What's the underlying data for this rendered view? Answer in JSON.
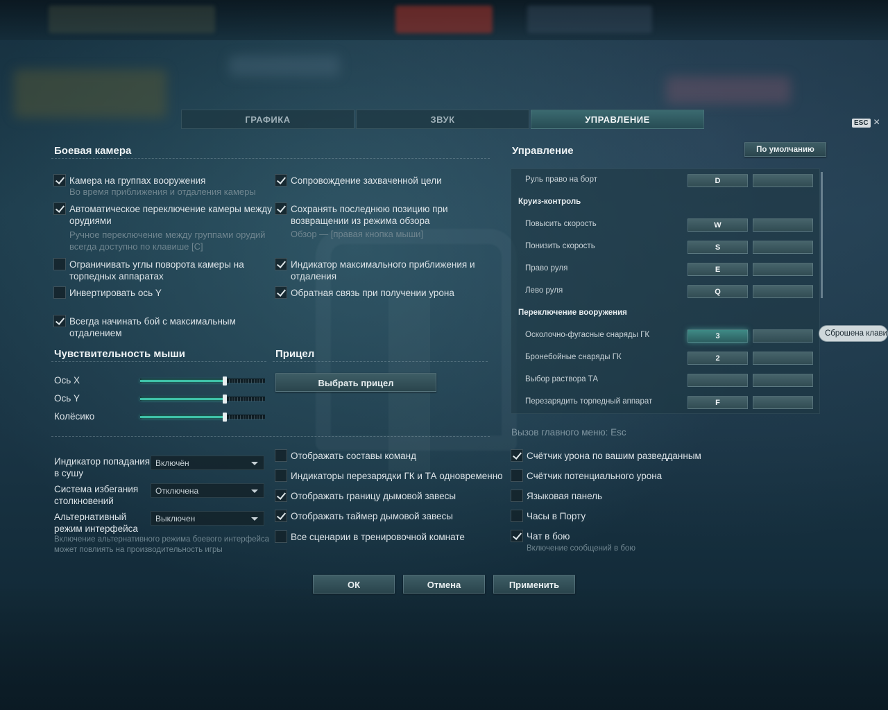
{
  "tabs": [
    {
      "label": "ГРАФИКА"
    },
    {
      "label": "ЗВУК"
    },
    {
      "label": "УПРАВЛЕНИЕ"
    }
  ],
  "esc_label": "ESC",
  "close_glyph": "×",
  "camera": {
    "title": "Боевая камера",
    "items": [
      {
        "label": "Камера на группах вооружения",
        "hint": "Во время приближения и отдаления камеры",
        "checked": true
      },
      {
        "label_line1": "Автоматическое переключение камеры между",
        "label_line2": "орудиями",
        "hint_line1": "Ручное переключение между группами орудий",
        "hint_line2": "всегда доступно по клавише [C]",
        "checked": true
      },
      {
        "label_line1": "Ограничивать углы поворота камеры на",
        "label_line2": "торпедных аппаратах",
        "checked": false
      },
      {
        "label": "Инвертировать ось Y",
        "checked": false
      },
      {
        "label_line1": "Всегда начинать бой с максимальным",
        "label_line2": "отдалением",
        "checked": true
      },
      {
        "label": "Сопровождение захваченной цели",
        "checked": true
      },
      {
        "label_line1": "Сохранять последнюю позицию при",
        "label_line2": "возвращении из режима обзора",
        "hint": "Обзор — [правая кнопка мыши]",
        "checked": true
      },
      {
        "label_line1": "Индикатор максимального приближения и",
        "label_line2": "отдаления",
        "checked": true
      },
      {
        "label": "Обратная связь при получении урона",
        "checked": true
      }
    ]
  },
  "mouse": {
    "title": "Чувствительность мыши",
    "sliders": [
      {
        "label": "Ось X",
        "value": 0.68
      },
      {
        "label": "Ось Y",
        "value": 0.68
      },
      {
        "label": "Колёсико",
        "value": 0.68
      }
    ]
  },
  "sight": {
    "title": "Прицел",
    "button_label": "Выбрать прицел"
  },
  "dropdowns": [
    {
      "label_line1": "Индикатор попадания",
      "label_line2": "в сушу",
      "value": "Включён"
    },
    {
      "label_line1": "Система избегания",
      "label_line2": "столкновений",
      "value": "Отключена"
    },
    {
      "label_line1": "Альтернативный",
      "label_line2": "режим интерфейса",
      "value": "Выключен"
    }
  ],
  "dropdown_hint_line1": "Включение альтернативного режима боевого интерфейса",
  "dropdown_hint_line2": "может повлиять на производительность игры",
  "middle_options": [
    {
      "label": "Отображать составы команд",
      "checked": false
    },
    {
      "label": "Индикаторы перезарядки ГК и ТА одновременно",
      "checked": false
    },
    {
      "label": "Отображать границу дымовой завесы",
      "checked": true
    },
    {
      "label": "Отображать таймер дымовой завесы",
      "checked": true
    },
    {
      "label": "Все сценарии в тренировочной комнате",
      "checked": false
    }
  ],
  "controls": {
    "title": "Управление",
    "default_button": "По умолчанию",
    "rows": [
      {
        "type": "bind",
        "name": "Руль право на борт",
        "key1": "D",
        "key2": ""
      },
      {
        "type": "group",
        "name": "Круиз-контроль"
      },
      {
        "type": "bind",
        "name": "Повысить скорость",
        "key1": "W",
        "key2": ""
      },
      {
        "type": "bind",
        "name": "Понизить скорость",
        "key1": "S",
        "key2": ""
      },
      {
        "type": "bind",
        "name": "Право руля",
        "key1": "E",
        "key2": ""
      },
      {
        "type": "bind",
        "name": "Лево руля",
        "key1": "Q",
        "key2": ""
      },
      {
        "type": "group",
        "name": "Переключение вооружения"
      },
      {
        "type": "bind",
        "name": "Осколочно-фугасные снаряды ГК",
        "key1": "3",
        "key2": ""
      },
      {
        "type": "bind",
        "name": "Бронебойные снаряды ГК",
        "key1": "2",
        "key2": ""
      },
      {
        "type": "bind",
        "name": "Выбор раствора ТА",
        "key1": "",
        "key2": ""
      },
      {
        "type": "bind",
        "name": "Перезарядить торпедный аппарат",
        "key1": "F",
        "key2": ""
      }
    ],
    "tooltip": "Сброшена клавиша",
    "menu_hint": "Вызов главного меню: Esc"
  },
  "right_options": [
    {
      "label": "Счётчик урона по вашим разведданным",
      "checked": true
    },
    {
      "label": "Счётчик потенциального урона",
      "checked": false
    },
    {
      "label": "Языковая панель",
      "checked": false
    },
    {
      "label": "Часы в Порту",
      "checked": false
    },
    {
      "label": "Чат в бою",
      "hint": "Включение сообщений в бою",
      "checked": true
    }
  ],
  "footer": {
    "ok": "ОК",
    "cancel": "Отмена",
    "apply": "Применить"
  }
}
